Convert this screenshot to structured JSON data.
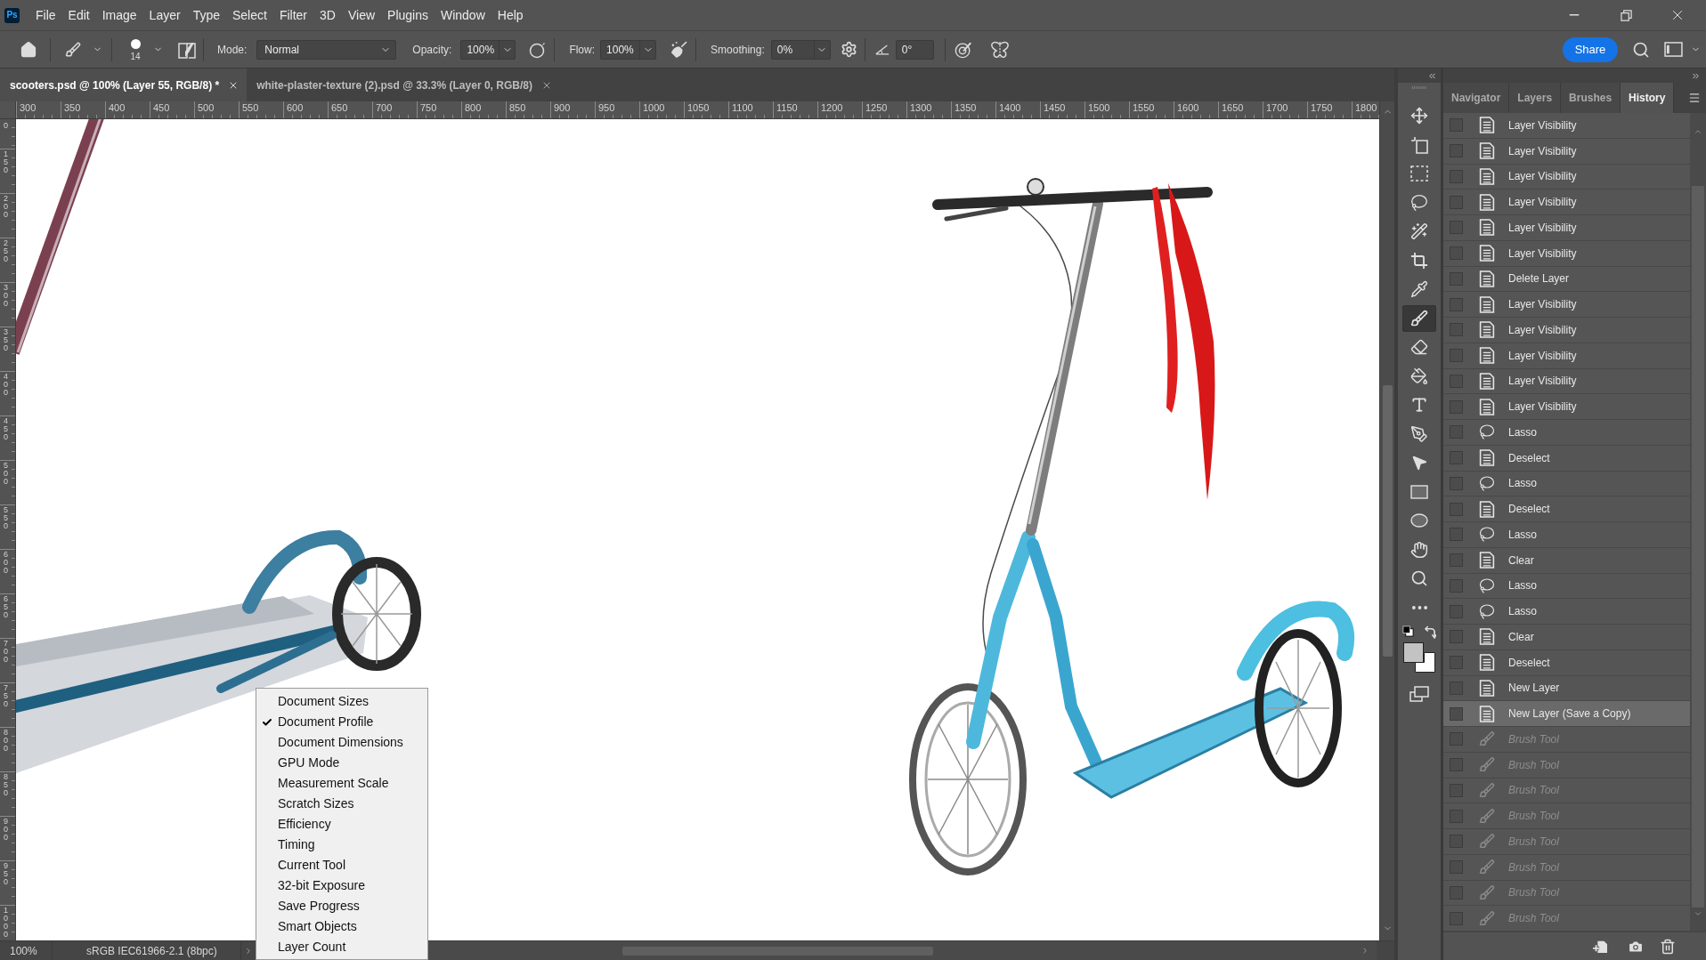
{
  "app": {
    "logo": "Ps"
  },
  "menu": [
    "File",
    "Edit",
    "Image",
    "Layer",
    "Type",
    "Select",
    "Filter",
    "3D",
    "View",
    "Plugins",
    "Window",
    "Help"
  ],
  "options_bar": {
    "brush_size": "14",
    "mode_label": "Mode:",
    "mode": "Normal",
    "opacity_label": "Opacity:",
    "opacity": "100%",
    "flow_label": "Flow:",
    "flow": "100%",
    "smoothing_label": "Smoothing:",
    "smoothing": "0%",
    "angle": "0°",
    "share_button": "Share"
  },
  "document_tabs": [
    {
      "title": "scooters.psd @ 100% (Layer 55, RGB/8) *",
      "selected": true
    },
    {
      "title": "white-plaster-texture (2).psd @ 33.3% (Layer 0, RGB/8)",
      "selected": false
    }
  ],
  "rulers": {
    "horizontal": [
      "300",
      "350",
      "400",
      "450",
      "500",
      "550",
      "600",
      "650",
      "700",
      "750",
      "800",
      "850",
      "900",
      "950",
      "1000",
      "1050",
      "1100",
      "1150",
      "1200",
      "1250",
      "1300",
      "1350",
      "1400",
      "1450",
      "1500",
      "1550",
      "1600",
      "1650",
      "1700",
      "1750",
      "1800"
    ],
    "vertical": [
      "0",
      "150",
      "200",
      "250",
      "300",
      "350",
      "400",
      "450",
      "500",
      "550",
      "600",
      "650",
      "700",
      "750",
      "800",
      "850",
      "900",
      "950",
      "1000"
    ]
  },
  "status_bar": {
    "zoom": "100%",
    "document_info": "sRGB IEC61966-2.1 (8bpc)"
  },
  "context_menu": [
    {
      "label": "Document Sizes",
      "checked": false
    },
    {
      "label": "Document Profile",
      "checked": true
    },
    {
      "label": "Document Dimensions",
      "checked": false
    },
    {
      "label": "GPU Mode",
      "checked": false
    },
    {
      "label": "Measurement Scale",
      "checked": false
    },
    {
      "label": "Scratch Sizes",
      "checked": false
    },
    {
      "label": "Efficiency",
      "checked": false
    },
    {
      "label": "Timing",
      "checked": false
    },
    {
      "label": "Current Tool",
      "checked": false
    },
    {
      "label": "32-bit Exposure",
      "checked": false
    },
    {
      "label": "Save Progress",
      "checked": false
    },
    {
      "label": "Smart Objects",
      "checked": false
    },
    {
      "label": "Layer Count",
      "checked": false
    }
  ],
  "tools": [
    {
      "kind": "move",
      "selected": false
    },
    {
      "kind": "artboard",
      "selected": false
    },
    {
      "kind": "marquee",
      "selected": false
    },
    {
      "kind": "lasso",
      "selected": false
    },
    {
      "kind": "magic-wand",
      "selected": false
    },
    {
      "kind": "crop",
      "selected": false
    },
    {
      "kind": "eyedropper",
      "selected": false
    },
    {
      "kind": "brush",
      "selected": true
    },
    {
      "kind": "eraser",
      "selected": false
    },
    {
      "kind": "paint-bucket",
      "selected": false
    },
    {
      "kind": "type",
      "selected": false
    },
    {
      "kind": "pen",
      "selected": false
    },
    {
      "kind": "path-selection",
      "selected": false
    },
    {
      "kind": "rectangle",
      "selected": false
    },
    {
      "kind": "ellipse",
      "selected": false
    },
    {
      "kind": "hand",
      "selected": false
    },
    {
      "kind": "zoom",
      "selected": false
    },
    {
      "kind": "more",
      "selected": false
    }
  ],
  "color_swatches": [
    {
      "color": "#c3c3c3"
    },
    {
      "color": "#ffffff"
    }
  ],
  "panel_tabs": [
    {
      "label": "Navigator",
      "selected": false
    },
    {
      "label": "Layers",
      "selected": false
    },
    {
      "label": "Brushes",
      "selected": false
    },
    {
      "label": "History",
      "selected": true
    }
  ],
  "history": [
    {
      "label": "Layer Visibility",
      "kind": "document",
      "checked": false,
      "selected": false,
      "disabled": false
    },
    {
      "label": "Layer Visibility",
      "kind": "document",
      "checked": false,
      "selected": false,
      "disabled": false
    },
    {
      "label": "Layer Visibility",
      "kind": "document",
      "checked": false,
      "selected": false,
      "disabled": false
    },
    {
      "label": "Layer Visibility",
      "kind": "document",
      "checked": false,
      "selected": false,
      "disabled": false
    },
    {
      "label": "Layer Visibility",
      "kind": "document",
      "checked": false,
      "selected": false,
      "disabled": false
    },
    {
      "label": "Layer Visibility",
      "kind": "document",
      "checked": false,
      "selected": false,
      "disabled": false
    },
    {
      "label": "Delete Layer",
      "kind": "document",
      "checked": false,
      "selected": false,
      "disabled": false
    },
    {
      "label": "Layer Visibility",
      "kind": "document",
      "checked": false,
      "selected": false,
      "disabled": false
    },
    {
      "label": "Layer Visibility",
      "kind": "document",
      "checked": false,
      "selected": false,
      "disabled": false
    },
    {
      "label": "Layer Visibility",
      "kind": "document",
      "checked": false,
      "selected": false,
      "disabled": false
    },
    {
      "label": "Layer Visibility",
      "kind": "document",
      "checked": false,
      "selected": false,
      "disabled": false
    },
    {
      "label": "Layer Visibility",
      "kind": "document",
      "checked": false,
      "selected": false,
      "disabled": false
    },
    {
      "label": "Lasso",
      "kind": "lasso",
      "checked": false,
      "selected": false,
      "disabled": false
    },
    {
      "label": "Deselect",
      "kind": "document",
      "checked": false,
      "selected": false,
      "disabled": false
    },
    {
      "label": "Lasso",
      "kind": "lasso",
      "checked": false,
      "selected": false,
      "disabled": false
    },
    {
      "label": "Deselect",
      "kind": "document",
      "checked": false,
      "selected": false,
      "disabled": false
    },
    {
      "label": "Lasso",
      "kind": "lasso",
      "checked": false,
      "selected": false,
      "disabled": false
    },
    {
      "label": "Clear",
      "kind": "document",
      "checked": false,
      "selected": false,
      "disabled": false
    },
    {
      "label": "Lasso",
      "kind": "lasso",
      "checked": false,
      "selected": false,
      "disabled": false
    },
    {
      "label": "Lasso",
      "kind": "lasso",
      "checked": false,
      "selected": false,
      "disabled": false
    },
    {
      "label": "Clear",
      "kind": "document",
      "checked": false,
      "selected": false,
      "disabled": false
    },
    {
      "label": "Deselect",
      "kind": "document",
      "checked": false,
      "selected": false,
      "disabled": false
    },
    {
      "label": "New Layer",
      "kind": "document",
      "checked": false,
      "selected": false,
      "disabled": false
    },
    {
      "label": "New Layer (Save a Copy)",
      "kind": "document",
      "checked": false,
      "selected": true,
      "disabled": false
    },
    {
      "label": "Brush Tool",
      "kind": "brush",
      "checked": false,
      "selected": false,
      "disabled": true
    },
    {
      "label": "Brush Tool",
      "kind": "brush",
      "checked": false,
      "selected": false,
      "disabled": true
    },
    {
      "label": "Brush Tool",
      "kind": "brush",
      "checked": false,
      "selected": false,
      "disabled": true
    },
    {
      "label": "Brush Tool",
      "kind": "brush",
      "checked": false,
      "selected": false,
      "disabled": true
    },
    {
      "label": "Brush Tool",
      "kind": "brush",
      "checked": false,
      "selected": false,
      "disabled": true
    },
    {
      "label": "Brush Tool",
      "kind": "brush",
      "checked": false,
      "selected": false,
      "disabled": true
    },
    {
      "label": "Brush Tool",
      "kind": "brush",
      "checked": false,
      "selected": false,
      "disabled": true
    },
    {
      "label": "Brush Tool",
      "kind": "brush",
      "checked": false,
      "selected": false,
      "disabled": true
    }
  ]
}
